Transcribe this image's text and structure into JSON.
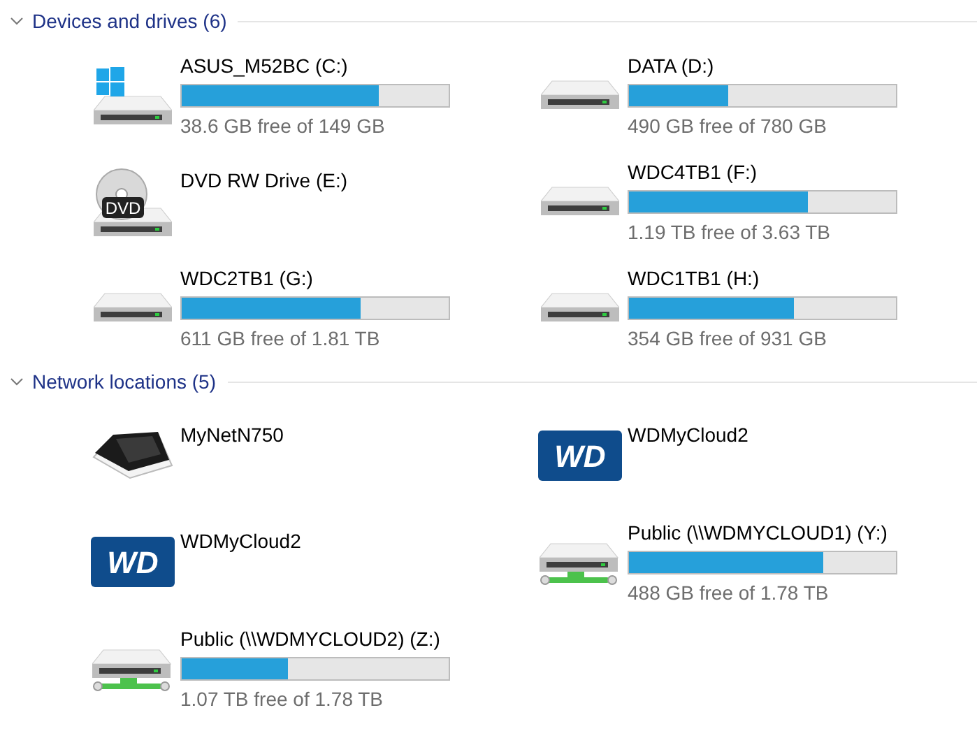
{
  "sections": [
    {
      "title": "Devices and drives (6)",
      "expanded": true,
      "items": [
        {
          "kind": "system-drive",
          "name": "ASUS_M52BC (C:)",
          "level": 0.74,
          "free": "38.6 GB free of 149 GB"
        },
        {
          "kind": "drive",
          "name": "DATA (D:)",
          "level": 0.37,
          "free": "490 GB free of 780 GB"
        },
        {
          "kind": "dvd-drive",
          "name": "DVD RW Drive (E:)",
          "badge": "DVD"
        },
        {
          "kind": "drive",
          "name": "WDC4TB1 (F:)",
          "level": 0.67,
          "free": "1.19 TB free of 3.63 TB"
        },
        {
          "kind": "drive",
          "name": "WDC2TB1 (G:)",
          "level": 0.67,
          "free": "611 GB free of 1.81 TB"
        },
        {
          "kind": "drive",
          "name": "WDC1TB1 (H:)",
          "level": 0.62,
          "free": "354 GB free of 931 GB"
        }
      ]
    },
    {
      "title": "Network locations (5)",
      "expanded": true,
      "items": [
        {
          "kind": "router",
          "name": "MyNetN750"
        },
        {
          "kind": "wd-logo",
          "name": "WDMyCloud2",
          "badge": "WD"
        },
        {
          "kind": "wd-logo",
          "name": "WDMyCloud2",
          "badge": "WD"
        },
        {
          "kind": "network-drive",
          "name": "Public (\\\\WDMYCLOUD1) (Y:)",
          "level": 0.73,
          "free": "488 GB free of 1.78 TB"
        },
        {
          "kind": "network-drive",
          "name": "Public (\\\\WDMYCLOUD2) (Z:)",
          "level": 0.4,
          "free": "1.07 TB free of 1.78 TB"
        }
      ]
    }
  ]
}
